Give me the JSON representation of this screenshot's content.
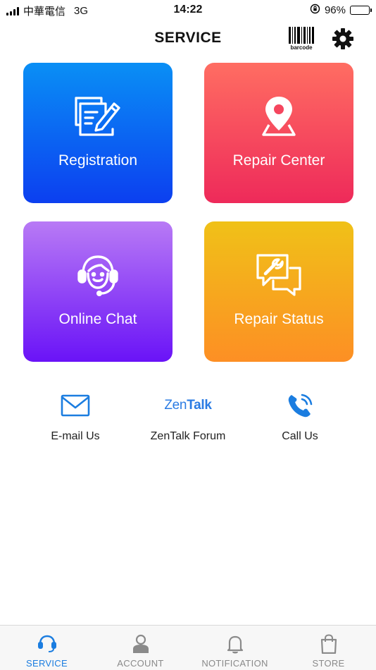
{
  "status_bar": {
    "carrier": "中華電信",
    "network": "3G",
    "time": "14:22",
    "battery_percent": "96%",
    "battery_level": 0.96
  },
  "header": {
    "title": "SERVICE",
    "barcode_label": "barcode",
    "barcode_icon": "barcode-icon",
    "settings_icon": "gear-icon"
  },
  "tiles": [
    {
      "label": "Registration",
      "icon": "registration-form-icon",
      "color_top": "#0a8ff5",
      "color_bottom": "#0c3ff0"
    },
    {
      "label": "Repair Center",
      "icon": "map-pin-icon",
      "color_top": "#ff6d62",
      "color_bottom": "#ee2a5a"
    },
    {
      "label": "Online Chat",
      "icon": "headset-agent-icon",
      "color_top": "#b87af5",
      "color_bottom": "#6a13f7"
    },
    {
      "label": "Repair Status",
      "icon": "wrench-chat-icon",
      "color_top": "#f0c118",
      "color_bottom": "#fd8f24"
    }
  ],
  "contacts": [
    {
      "label": "E-mail Us",
      "icon": "envelope-icon"
    },
    {
      "label": "ZenTalk Forum",
      "icon": "zentalk-logo",
      "logo_zen": "Zen",
      "logo_talk": "Talk"
    },
    {
      "label": "Call Us",
      "icon": "phone-call-icon"
    }
  ],
  "tabbar": {
    "active": "SERVICE",
    "accent": "#1b7de0",
    "items": [
      {
        "label": "SERVICE",
        "icon": "headset-icon"
      },
      {
        "label": "ACCOUNT",
        "icon": "user-icon"
      },
      {
        "label": "NOTIFICATION",
        "icon": "bell-icon"
      },
      {
        "label": "STORE",
        "icon": "shopping-bag-icon"
      }
    ]
  }
}
